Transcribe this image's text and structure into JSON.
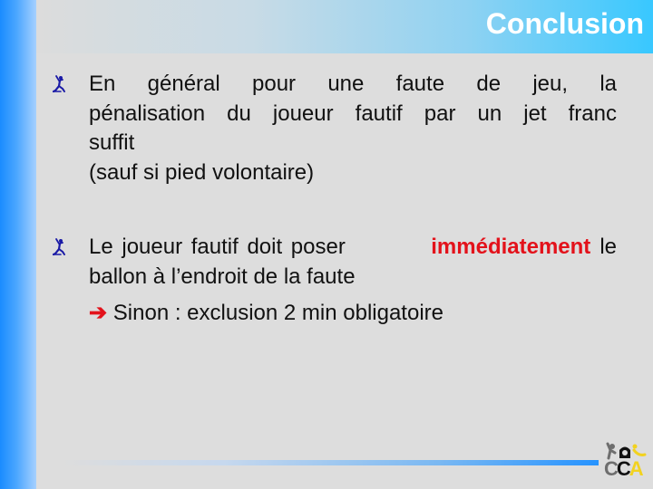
{
  "slide": {
    "title": "Conclusion",
    "bullets": [
      {
        "icon": "handball-player-icon",
        "lines": [
          "En général pour une faute de jeu, la",
          "pénalisation du joueur fautif par un jet franc",
          "suffit",
          "(sauf si pied volontaire)"
        ]
      },
      {
        "icon": "handball-player-icon",
        "line1_before": "Le joueur fautif doit poser ",
        "line1_highlight": "immédiatement",
        "line1_after": " le",
        "line2": "ballon à l’endroit de la faute",
        "sub_arrow": "➔",
        "sub_text": " Sinon : exclusion 2 min obligatoire"
      }
    ]
  },
  "logo": {
    "letters": [
      "C",
      "C",
      "A"
    ],
    "colors": [
      "#6e6e6e",
      "#111111",
      "#f2d21f"
    ]
  },
  "colors": {
    "accent_blue": "#1a8cff",
    "title_text": "#ffffff",
    "highlight_red": "#e3121b",
    "bullet_blue": "#1a1aa6"
  }
}
